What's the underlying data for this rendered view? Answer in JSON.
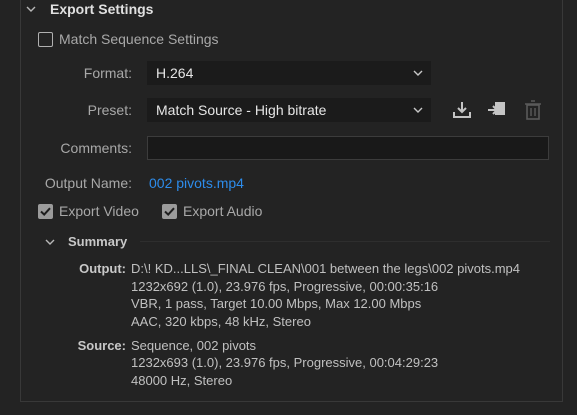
{
  "export_settings": {
    "title": "Export Settings",
    "match_sequence": {
      "label": "Match Sequence Settings",
      "checked": false
    },
    "format": {
      "label": "Format:",
      "value": "H.264"
    },
    "preset": {
      "label": "Preset:",
      "value": "Match Source - High bitrate"
    },
    "comments": {
      "label": "Comments:",
      "value": ""
    },
    "output_name": {
      "label": "Output Name:",
      "value": "002 pivots.mp4"
    },
    "export_video": {
      "label": "Export Video",
      "checked": true
    },
    "export_audio": {
      "label": "Export Audio",
      "checked": true
    },
    "preset_icons": [
      "save-preset-icon",
      "import-preset-icon",
      "delete-preset-icon"
    ]
  },
  "summary": {
    "title": "Summary",
    "output": {
      "label": "Output:",
      "lines": [
        "D:\\! KD...LLS\\_FINAL CLEAN\\001 between the legs\\002 pivots.mp4",
        "1232x692 (1.0), 23.976 fps, Progressive, 00:00:35:16",
        "VBR, 1 pass, Target 10.00 Mbps, Max 12.00 Mbps",
        "AAC, 320 kbps, 48 kHz, Stereo"
      ]
    },
    "source": {
      "label": "Source:",
      "lines": [
        "Sequence, 002 pivots",
        "1232x693 (1.0), 23.976 fps, Progressive, 00:04:29:23",
        "48000 Hz, Stereo"
      ]
    }
  },
  "colors": {
    "link": "#2d8ceb",
    "background": "#232323",
    "field": "#1b1b1b"
  }
}
